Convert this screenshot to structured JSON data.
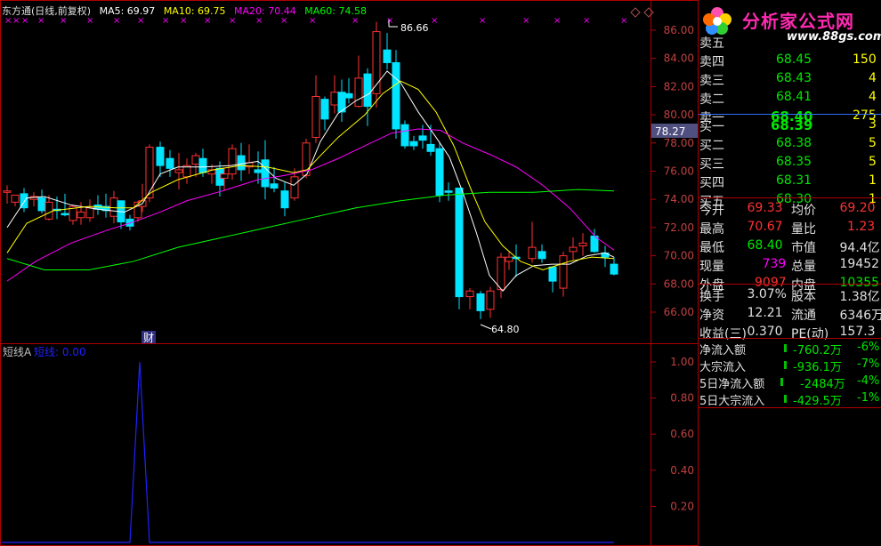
{
  "header": {
    "stock_name": "东方通(日线,前复权)",
    "ma5": "MA5: 69.97",
    "ma10": "MA10: 69.75",
    "ma20": "MA20: 70.44",
    "ma60": "MA60: 74.58"
  },
  "colors": {
    "up": "#ff3232",
    "down": "#00e4ff",
    "ma5": "#ffffff",
    "ma10": "#ffff00",
    "ma20": "#ff00ff",
    "ma60": "#00ff00",
    "frame": "#b00000",
    "indicator": "#2020ff"
  },
  "price_axis": {
    "ticks": [
      "86.00",
      "84.00",
      "82.00",
      "80.00",
      "78.00",
      "76.00",
      "74.00",
      "72.00",
      "70.00",
      "68.00",
      "66.00"
    ],
    "current_price_tag": "78.27"
  },
  "annotations": {
    "high_label": "86.66",
    "low_label": "64.80",
    "news_marker": "财"
  },
  "indicator_panel": {
    "title": "短线A",
    "series_label": "短线: 0.00",
    "ticks": [
      "1.00",
      "0.80",
      "0.60",
      "0.40",
      "0.20"
    ]
  },
  "logo": {
    "text": "分析家公式网",
    "url": "www.88gs.com"
  },
  "order_book": {
    "sells": [
      {
        "label": "卖五",
        "price": "",
        "vol": ""
      },
      {
        "label": "卖四",
        "price": "68.45",
        "vol": "150"
      },
      {
        "label": "卖三",
        "price": "68.43",
        "vol": "4"
      },
      {
        "label": "卖二",
        "price": "68.41",
        "vol": "4"
      },
      {
        "label": "卖一",
        "price": "68.40",
        "vol": "275"
      }
    ],
    "buys": [
      {
        "label": "买一",
        "price": "68.39",
        "vol": "3"
      },
      {
        "label": "买二",
        "price": "68.38",
        "vol": "5"
      },
      {
        "label": "买三",
        "price": "68.35",
        "vol": "5"
      },
      {
        "label": "买四",
        "price": "68.31",
        "vol": "1"
      },
      {
        "label": "买五",
        "price": "68.30",
        "vol": "1"
      }
    ]
  },
  "quote": [
    {
      "l1": "今开",
      "v1": "69.33",
      "l2": "均价",
      "v2": "69.20",
      "c1": "#ff3232",
      "c2": "#ff3232"
    },
    {
      "l1": "最高",
      "v1": "70.67",
      "l2": "量比",
      "v2": "1.23",
      "c1": "#ff3232",
      "c2": "#ff3232"
    },
    {
      "l1": "最低",
      "v1": "68.40",
      "l2": "市值",
      "v2": "94.4亿",
      "c1": "#00e600",
      "c2": "#e0e0e0"
    },
    {
      "l1": "现量",
      "v1": "739",
      "l2": "总量",
      "v2": "19452",
      "c1": "#ff00ff",
      "c2": "#e0e0e0"
    },
    {
      "l1": "外盘",
      "v1": "9097",
      "l2": "内盘",
      "v2": "10355",
      "c1": "#ff3232",
      "c2": "#00e600"
    }
  ],
  "fundamentals": [
    {
      "l1": "换手",
      "v1": "3.07%",
      "l2": "股本",
      "v2": "1.38亿"
    },
    {
      "l1": "净资",
      "v1": "12.21",
      "l2": "流通",
      "v2": "6346万"
    },
    {
      "l1": "收益(三)",
      "v1": "0.370",
      "l2": "PE(动)",
      "v2": "157.3"
    }
  ],
  "flows": [
    {
      "label": "净流入额",
      "value": "-760.2万",
      "pct": "-6%"
    },
    {
      "label": "大宗流入",
      "value": "-936.1万",
      "pct": "-7%"
    },
    {
      "label": "5日净流入额",
      "value": "-2484万",
      "pct": "-4%"
    },
    {
      "label": "5日大宗流入",
      "value": "-429.5万",
      "pct": "-1%"
    }
  ]
}
